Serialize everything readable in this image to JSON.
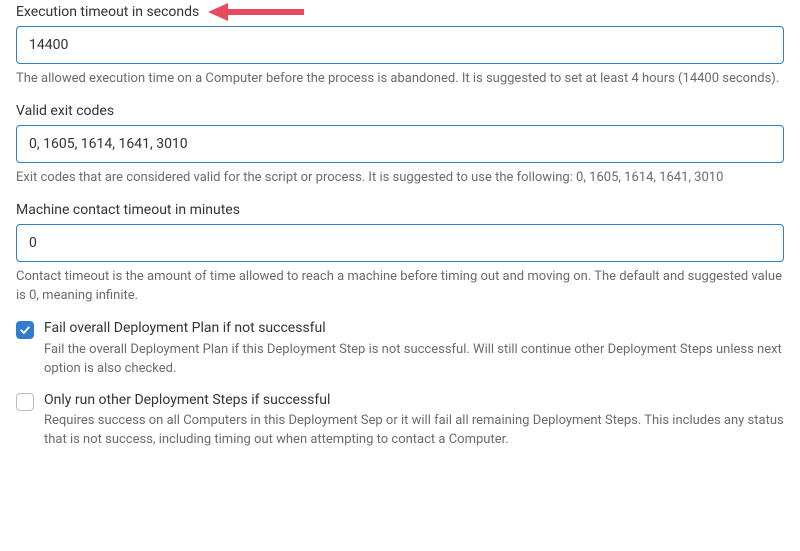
{
  "fields": {
    "exec_timeout": {
      "label": "Execution timeout in seconds",
      "value": "14400",
      "help": "The allowed execution time on a Computer before the process is abandoned. It is suggested to set at least 4 hours (14400 seconds)."
    },
    "exit_codes": {
      "label": "Valid exit codes",
      "value": "0, 1605, 1614, 1641, 3010",
      "help": "Exit codes that are considered valid for the script or process. It is suggested to use the following: 0, 1605, 1614, 1641, 3010"
    },
    "contact_timeout": {
      "label": "Machine contact timeout in minutes",
      "value": "0",
      "help": "Contact timeout is the amount of time allowed to reach a machine before timing out and moving on. The default and suggested value is 0, meaning infinite."
    }
  },
  "checks": {
    "fail_overall": {
      "label": "Fail overall Deployment Plan if not successful",
      "desc": "Fail the overall Deployment Plan if this Deployment Step is not successful. Will still continue other Deployment Steps unless next option is also checked."
    },
    "only_run_if_success": {
      "label": "Only run other Deployment Steps if successful",
      "desc": "Requires success on all Computers in this Deployment Sep or it will fail all remaining Deployment Steps. This includes any status that is not success, including timing out when attempting to contact a Computer."
    }
  },
  "colors": {
    "accent": "#2f7dcc",
    "annotation": "#e84a5f"
  }
}
